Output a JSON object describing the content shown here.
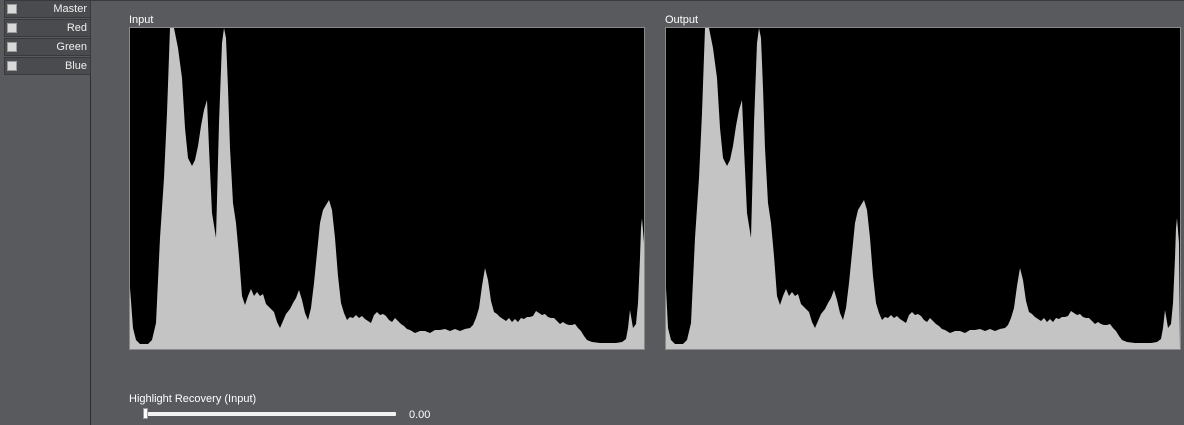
{
  "channels": [
    {
      "label": "Master",
      "checked": false
    },
    {
      "label": "Red",
      "checked": false
    },
    {
      "label": "Green",
      "checked": false
    },
    {
      "label": "Blue",
      "checked": false
    }
  ],
  "panels": {
    "input_title": "Input",
    "output_title": "Output"
  },
  "highlight_recovery": {
    "label": "Highlight Recovery (Input)",
    "value_text": "0.00",
    "value": 0.0
  },
  "colors": {
    "background": "#595a5e",
    "histogram_bg": "#000000",
    "histogram_fill": "#c4c4c4"
  }
}
